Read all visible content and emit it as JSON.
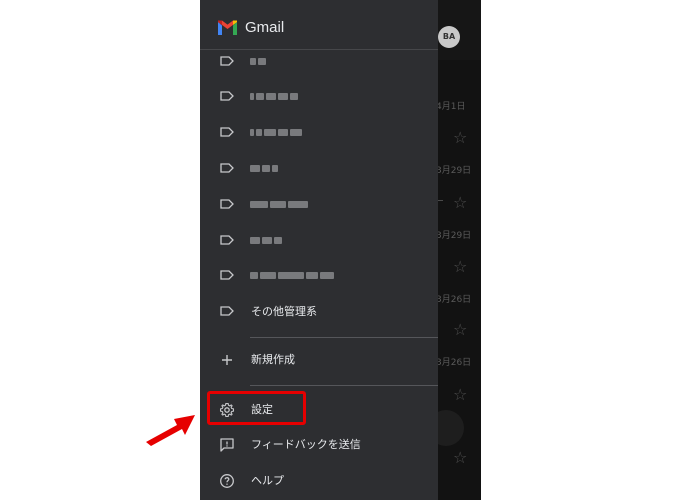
{
  "app": {
    "title": "Gmail"
  },
  "inbox_background": {
    "avatar": "BA",
    "dates": [
      "4月1日",
      "3月29日",
      "3月29日",
      "3月26日",
      "3月26日"
    ]
  },
  "drawer": {
    "label_items_redacted": 7,
    "other_labels": "その他管理系",
    "create_new": "新規作成",
    "settings": "設定",
    "feedback": "フィードバックを送信",
    "help": "ヘルプ"
  },
  "colors": {
    "drawer_bg": "#2d2e31",
    "highlight": "#e60000",
    "arrow": "#e60000"
  },
  "icons": [
    "gmail-logo-icon",
    "label-icon",
    "plus-icon",
    "gear-icon",
    "feedback-icon",
    "help-icon",
    "star-icon"
  ]
}
